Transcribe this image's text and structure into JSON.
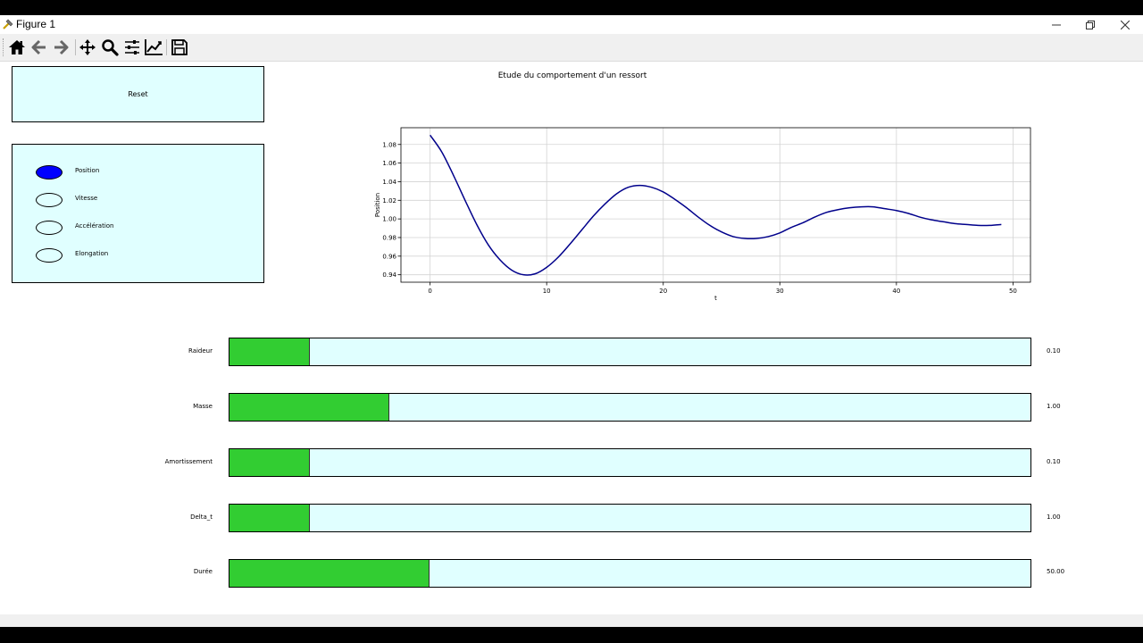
{
  "window": {
    "title": "Figure 1",
    "controls": {
      "minimize": "minimize-icon",
      "restore": "restore-icon",
      "close": "close-icon"
    }
  },
  "toolbar": {
    "buttons": [
      {
        "name": "home",
        "icon": "home-icon"
      },
      {
        "name": "back",
        "icon": "arrow-left-icon"
      },
      {
        "name": "forward",
        "icon": "arrow-right-icon"
      },
      {
        "name": "pan",
        "icon": "move-icon"
      },
      {
        "name": "zoom",
        "icon": "zoom-icon"
      },
      {
        "name": "configure-subplots",
        "icon": "sliders-icon"
      },
      {
        "name": "edit-axes",
        "icon": "line-chart-icon"
      },
      {
        "name": "save",
        "icon": "save-icon"
      }
    ]
  },
  "reset_label": "Reset",
  "radio": {
    "options": [
      "Position",
      "Vitesse",
      "Accélération",
      "Elongation"
    ],
    "selected": "Position"
  },
  "sliders": [
    {
      "label": "Raideur",
      "value_text": "0.10",
      "fill_fraction": 0.1
    },
    {
      "label": "Masse",
      "value_text": "1.00",
      "fill_fraction": 0.2
    },
    {
      "label": "Amortissement",
      "value_text": "0.10",
      "fill_fraction": 0.1
    },
    {
      "label": "Delta_t",
      "value_text": "1.00",
      "fill_fraction": 0.1
    },
    {
      "label": "Durée",
      "value_text": "50.00",
      "fill_fraction": 0.25
    }
  ],
  "colors": {
    "panel_bg": "#e0ffff",
    "slider_fill": "#32cd32",
    "radio_selected": "#0000ff",
    "line": "#00008b",
    "grid": "#d3d3d3"
  },
  "chart_data": {
    "type": "line",
    "title": "Etude du comportement d'un ressort",
    "xlabel": "t",
    "ylabel": "Position",
    "xlim": [
      -2.5,
      51.5
    ],
    "ylim": [
      0.932,
      1.098
    ],
    "xticks": [
      0,
      10,
      20,
      30,
      40,
      50
    ],
    "yticks": [
      0.94,
      0.96,
      0.98,
      1.0,
      1.02,
      1.04,
      1.06,
      1.08
    ],
    "ytick_labels": [
      "0.94",
      "0.96",
      "0.98",
      "1.00",
      "1.02",
      "1.04",
      "1.06",
      "1.08"
    ],
    "grid": true,
    "series": [
      {
        "color": "#00008b",
        "x": [
          0,
          1,
          2,
          3,
          4,
          5,
          6,
          7,
          8,
          9,
          10,
          11,
          12,
          13,
          14,
          15,
          16,
          17,
          18,
          19,
          20,
          21,
          22,
          23,
          24,
          25,
          26,
          27,
          28,
          29,
          30,
          31,
          32,
          33,
          34,
          35,
          36,
          37,
          38,
          39,
          40,
          41,
          42,
          43,
          44,
          45,
          46,
          47,
          48,
          49
        ],
        "y": [
          1.09,
          1.072,
          1.047,
          1.02,
          0.994,
          0.972,
          0.956,
          0.945,
          0.94,
          0.941,
          0.948,
          0.959,
          0.973,
          0.988,
          1.003,
          1.016,
          1.027,
          1.034,
          1.036,
          1.034,
          1.029,
          1.021,
          1.012,
          1.002,
          0.993,
          0.986,
          0.981,
          0.979,
          0.979,
          0.981,
          0.985,
          0.991,
          0.996,
          1.002,
          1.007,
          1.01,
          1.012,
          1.013,
          1.013,
          1.011,
          1.009,
          1.006,
          1.002,
          0.999,
          0.997,
          0.995,
          0.994,
          0.993,
          0.993,
          0.994
        ]
      }
    ]
  }
}
